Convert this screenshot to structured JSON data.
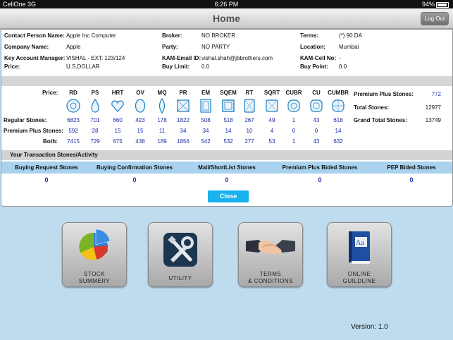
{
  "status": {
    "carrier": "CellOne",
    "network": "3G",
    "time": "6:26 PM",
    "battery": "94%"
  },
  "nav": {
    "title": "Home",
    "logout": "Log Out"
  },
  "info": {
    "contact_label": "Contact Person Name:",
    "contact": "Apple Inc Computer",
    "broker_label": "Broker:",
    "broker": "NO BROKER",
    "terms_label": "Terms:",
    "terms": "(*) 90 DA",
    "company_label": "Company Name:",
    "company": "Apple",
    "party_label": "Party:",
    "party": "NO PARTY",
    "location_label": "Location:",
    "location": "Mumbai",
    "kam_label": "Key Account Manager:",
    "kam": "VISHAL  -  EXT: 123/124",
    "kam_email_label": "KAM-Email ID:",
    "kam_email": "vishal.shah@jbbrothers.com",
    "kam_cell_label": "KAM-Cell No:",
    "kam_cell": "-",
    "price_label": "Price:",
    "price": "U.S.DOLLAR",
    "buy_limit_label": "Buy Limit:",
    "buy_limit": "0.0",
    "buy_point_label": "Buy Point:",
    "buy_point": "0.0"
  },
  "stones": {
    "price_label": "Price:",
    "regular_label": "Regular Stones:",
    "premium_label": "Premium Plus Stones:",
    "both_label": "Both:",
    "shapes": [
      {
        "code": "RD",
        "regular": "6823",
        "premium": "592",
        "both": "7415"
      },
      {
        "code": "PS",
        "regular": "701",
        "premium": "28",
        "both": "729"
      },
      {
        "code": "HRT",
        "regular": "660",
        "premium": "15",
        "both": "675"
      },
      {
        "code": "OV",
        "regular": "423",
        "premium": "15",
        "both": "438"
      },
      {
        "code": "MQ",
        "regular": "178",
        "premium": "11",
        "both": "189"
      },
      {
        "code": "PR",
        "regular": "1822",
        "premium": "34",
        "both": "1856"
      },
      {
        "code": "EM",
        "regular": "508",
        "premium": "34",
        "both": "542"
      },
      {
        "code": "SQEM",
        "regular": "518",
        "premium": "14",
        "both": "532"
      },
      {
        "code": "RT",
        "regular": "267",
        "premium": "10",
        "both": "277"
      },
      {
        "code": "SQRT",
        "regular": "49",
        "premium": "4",
        "both": "53"
      },
      {
        "code": "CUBR",
        "regular": "1",
        "premium": "0",
        "both": "1"
      },
      {
        "code": "CU",
        "regular": "43",
        "premium": "0",
        "both": "43"
      },
      {
        "code": "CUMBR",
        "regular": "618",
        "premium": "14",
        "both": "632"
      }
    ],
    "summary": {
      "premium_plus_label": "Premium Plus Stones:",
      "premium_plus": "772",
      "total_label": "Total Stones:",
      "total": "12977",
      "grand_total_label": "Grand Total Stones:",
      "grand_total": "13749"
    }
  },
  "transactions": {
    "title": "Your Transaction Stones/Activity",
    "columns": [
      {
        "label": "Buying Request Stones",
        "value": "0"
      },
      {
        "label": "Buying Confirmation Stones",
        "value": "0"
      },
      {
        "label": "Mail/ShortList Stones",
        "value": "0"
      },
      {
        "label": "Premium Plus Bided Stones",
        "value": "0"
      },
      {
        "label": "PEP Bided Stones",
        "value": "0"
      }
    ],
    "close": "Close"
  },
  "tiles": [
    {
      "line1": "STOCK",
      "line2": "SUMMERY",
      "icon": "pie-chart-icon"
    },
    {
      "line1": "UTILITY",
      "line2": "",
      "icon": "tools-icon"
    },
    {
      "line1": "TERMS",
      "line2": "& CONDITIONS",
      "icon": "handshake-icon"
    },
    {
      "line1": "ONLINE",
      "line2": "GUILDLINE",
      "icon": "book-icon"
    }
  ],
  "version": "Version: 1.0",
  "colors": {
    "accent": "#19b2ef",
    "number": "#1b2fa8",
    "header_blue": "#a8d2ee",
    "background": "#bfdcef"
  }
}
